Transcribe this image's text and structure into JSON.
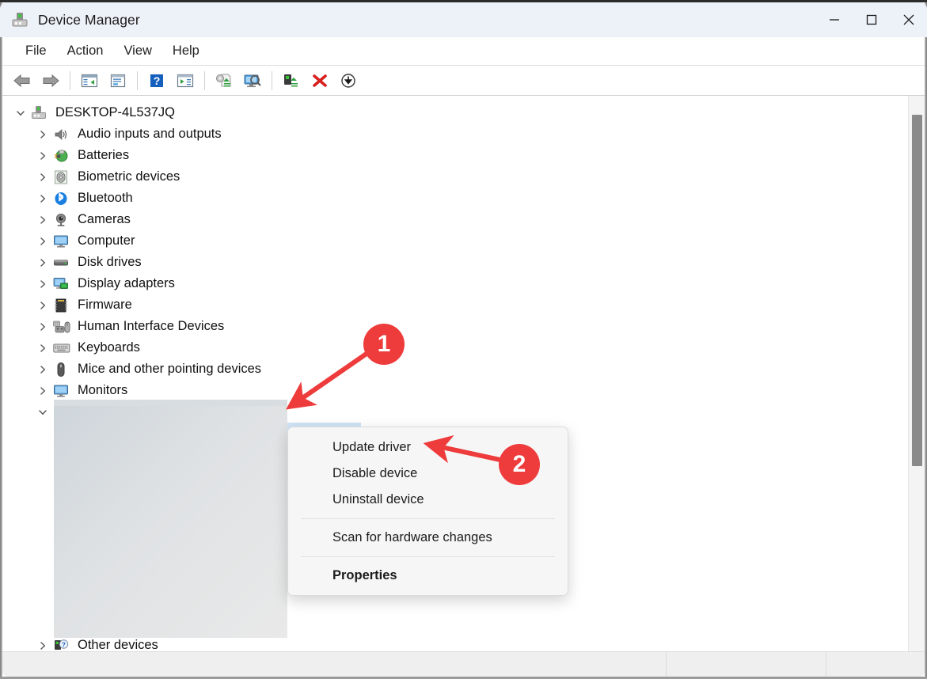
{
  "window": {
    "title": "Device Manager",
    "icon": "device-manager-icon",
    "controls": [
      {
        "name": "minimize-button",
        "glyph": "–"
      },
      {
        "name": "maximize-button",
        "glyph": "□"
      },
      {
        "name": "close-button",
        "glyph": "✕"
      }
    ]
  },
  "menubar": {
    "items": [
      {
        "label": "File"
      },
      {
        "label": "Action"
      },
      {
        "label": "View"
      },
      {
        "label": "Help"
      }
    ]
  },
  "toolbar": {
    "buttons": [
      {
        "name": "back-button",
        "icon": "back-arrow-icon",
        "title": "Back"
      },
      {
        "name": "forward-button",
        "icon": "forward-arrow-icon",
        "title": "Forward"
      },
      {
        "name": "show-hide-console-tree-button",
        "icon": "console-tree-icon",
        "title": "Show/Hide Console Tree"
      },
      {
        "name": "properties-button",
        "icon": "properties-icon",
        "title": "Properties"
      },
      {
        "name": "help-button",
        "icon": "help-question-icon",
        "title": "Help"
      },
      {
        "name": "show-hide-action-pane-button",
        "icon": "action-pane-icon",
        "title": "Show/Hide Action Pane"
      },
      {
        "name": "update-driver-button",
        "icon": "update-driver-icon",
        "title": "Update Driver"
      },
      {
        "name": "scan-for-hardware-changes-button",
        "icon": "scan-hardware-icon",
        "title": "Scan for hardware changes"
      },
      {
        "name": "enable-device-button",
        "icon": "enable-device-icon",
        "title": "Enable device"
      },
      {
        "name": "disable-device-button",
        "icon": "red-x-icon",
        "title": "Disable device"
      },
      {
        "name": "uninstall-device-button",
        "icon": "down-arrow-circle-icon",
        "title": "Uninstall device"
      }
    ]
  },
  "tree": {
    "root": {
      "label": "DESKTOP-4L537JQ",
      "icon": "computer-root-icon",
      "expanded": true
    },
    "items": [
      {
        "label": "Audio inputs and outputs",
        "icon": "speaker-icon",
        "expanded": false
      },
      {
        "label": "Batteries",
        "icon": "battery-icon",
        "expanded": false
      },
      {
        "label": "Biometric devices",
        "icon": "fingerprint-icon",
        "expanded": false
      },
      {
        "label": "Bluetooth",
        "icon": "bluetooth-icon",
        "expanded": false
      },
      {
        "label": "Cameras",
        "icon": "camera-icon",
        "expanded": false
      },
      {
        "label": "Computer",
        "icon": "monitor-icon",
        "expanded": false
      },
      {
        "label": "Disk drives",
        "icon": "disk-drive-icon",
        "expanded": false
      },
      {
        "label": "Display adapters",
        "icon": "display-adapter-icon",
        "expanded": false
      },
      {
        "label": "Firmware",
        "icon": "firmware-chip-icon",
        "expanded": false
      },
      {
        "label": "Human Interface Devices",
        "icon": "hid-icon",
        "expanded": false
      },
      {
        "label": "Keyboards",
        "icon": "keyboard-icon",
        "expanded": false
      },
      {
        "label": "Mice and other pointing devices",
        "icon": "mouse-icon",
        "expanded": false
      },
      {
        "label": "Monitors",
        "icon": "monitor-icon",
        "expanded": false
      }
    ],
    "redacted_node": {
      "label": "",
      "expanded": true,
      "note": "redacted"
    },
    "last_item": {
      "label": "Other devices",
      "icon": "unknown-device-icon",
      "expanded": false
    }
  },
  "context_menu": {
    "items": [
      {
        "label": "Update driver",
        "bold": false,
        "separator_after": false
      },
      {
        "label": "Disable device",
        "bold": false,
        "separator_after": false
      },
      {
        "label": "Uninstall device",
        "bold": false,
        "separator_after": true
      },
      {
        "label": "Scan for hardware changes",
        "bold": false,
        "separator_after": true
      },
      {
        "label": "Properties",
        "bold": true,
        "separator_after": false
      }
    ]
  },
  "annotations": [
    {
      "name": "annotation-marker-1",
      "number": "1",
      "points_to": "tree-selected-node"
    },
    {
      "name": "annotation-marker-2",
      "number": "2",
      "points_to": "context-menu-update-driver"
    }
  ],
  "statusbar": {
    "panes": [
      "",
      "",
      ""
    ]
  },
  "colors": {
    "accent_red": "#ee3b3b",
    "titlebar": "#edf1f8",
    "selection_blue": "#cfe4f7"
  }
}
